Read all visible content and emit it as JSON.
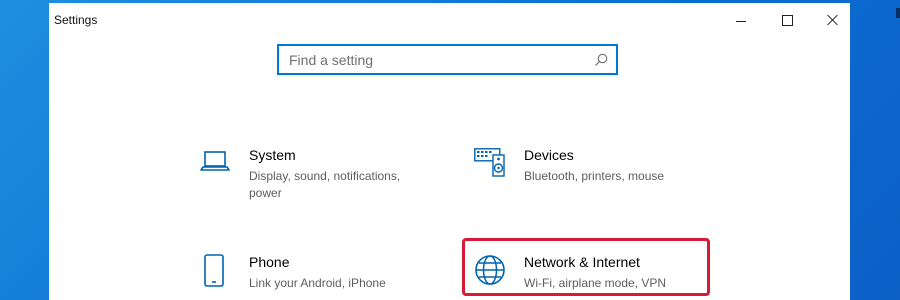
{
  "window": {
    "title": "Settings",
    "controls": {
      "minimize_icon": "minimize-icon",
      "maximize_icon": "maximize-icon",
      "close_icon": "close-icon"
    }
  },
  "search": {
    "placeholder": "Find a setting",
    "value": "",
    "icon": "search-icon"
  },
  "categories": [
    {
      "title": "System",
      "desc_1": "Display, sound, notifications,",
      "desc_2": "power",
      "icon": "laptop-icon"
    },
    {
      "title": "Devices",
      "desc_1": "Bluetooth, printers, mouse",
      "icon": "keyboard-speaker-icon"
    },
    {
      "title": "Phone",
      "desc_1": "Link your Android, iPhone",
      "icon": "phone-icon"
    },
    {
      "title": "Network & Internet",
      "desc_1": "Wi-Fi, airplane mode, VPN",
      "icon": "globe-icon"
    }
  ],
  "colors": {
    "accent": "#0078d4",
    "highlight": "#d71a35",
    "desktop": "#0b6fd3"
  }
}
